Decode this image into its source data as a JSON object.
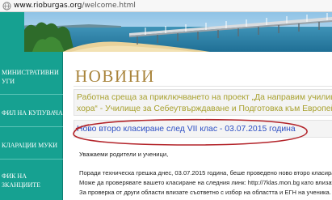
{
  "address_bar": {
    "host": "www.rioburgas.org",
    "path": "/welcome.html"
  },
  "sidebar": {
    "items": [
      {
        "lines": [
          "МИНИСТРАТИВНИ",
          "УГИ"
        ]
      },
      {
        "lines": [
          "ФИЛ НА КУПУВАЧА"
        ]
      },
      {
        "lines": [
          "КЛАРАЦИИ МУКИ"
        ]
      },
      {
        "lines": [
          "ФИК НА",
          "ЗКАНЦИИТЕ"
        ]
      }
    ]
  },
  "main": {
    "title": "НОВИНИ",
    "news": [
      {
        "lines": [
          "Работна среща за приключването на проект „Да направим училищет",
          "хора“ - Училище за Себеутвърждаване и Подготовка към Европейск"
        ]
      },
      {
        "lines": [
          "Ново второ класиране след VII клас - 03.07.2015 година"
        ]
      }
    ],
    "article": [
      "Уважаеми родители и ученици,",
      "Поради техническа грешка днес, 03.07.2015 година, беше проведено ново второ класиране.",
      "Може да проверявате вашето класиране на следния линк: http://7klas.mon.bg като влизате с",
      "За проверка от други области влизате съответно с избор на областта и ЕГН на ученика."
    ]
  },
  "colors": {
    "sidebar_bg": "#16a191",
    "title": "#a8833a",
    "news_link_1": "#a8a12f",
    "news_link_2": "#2e4fc4",
    "highlight_ellipse": "#b3242a"
  }
}
